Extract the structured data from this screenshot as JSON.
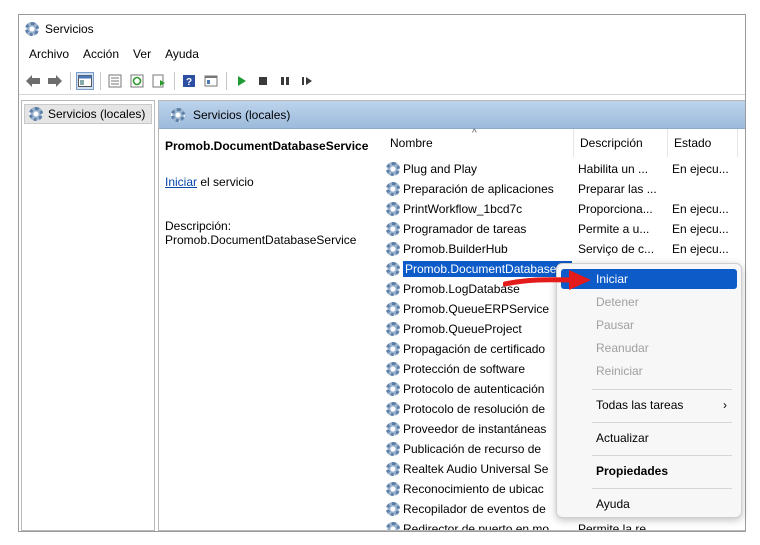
{
  "window": {
    "title": "Servicios"
  },
  "menu": [
    "Archivo",
    "Acción",
    "Ver",
    "Ayuda"
  ],
  "toolbar_icons": [
    "back-arrow-icon",
    "forward-arrow-icon",
    "console-tree-icon",
    "export-list-icon",
    "refresh-icon",
    "properties-icon",
    "help-icon",
    "view-icon",
    "play-icon",
    "stop-icon",
    "pause-icon",
    "resume-icon"
  ],
  "tree": {
    "item": "Servicios (locales)"
  },
  "pane": {
    "header": "Servicios (locales)"
  },
  "details": {
    "service_name": "Promob.DocumentDatabaseService",
    "start_link": "Iniciar",
    "start_suffix": " el servicio",
    "desc_label": "Descripción:",
    "desc_value": "Promob.DocumentDatabaseService"
  },
  "columns": {
    "name": "Nombre",
    "description": "Descripción",
    "status": "Estado"
  },
  "rows": [
    {
      "name": "Plug and Play",
      "description": "Habilita un ...",
      "status": "En ejecu..."
    },
    {
      "name": "Preparación de aplicaciones",
      "description": "Preparar las ...",
      "status": ""
    },
    {
      "name": "PrintWorkflow_1bcd7c",
      "description": "Proporciona...",
      "status": "En ejecu..."
    },
    {
      "name": "Programador de tareas",
      "description": "Permite a u...",
      "status": "En ejecu..."
    },
    {
      "name": "Promob.BuilderHub",
      "description": "Serviço de c...",
      "status": "En ejecu..."
    },
    {
      "name": "Promob.DocumentDatabaseService",
      "description": "",
      "status": ""
    },
    {
      "name": "Promob.LogDatabase",
      "description": "",
      "status": ""
    },
    {
      "name": "Promob.QueueERPService",
      "description": "",
      "status": ""
    },
    {
      "name": "Promob.QueueProject",
      "description": "",
      "status": ""
    },
    {
      "name": "Propagación de certificado",
      "description": "",
      "status": ""
    },
    {
      "name": "Protección de software",
      "description": "",
      "status": ""
    },
    {
      "name": "Protocolo de autenticación",
      "description": "",
      "status": ""
    },
    {
      "name": "Protocolo de resolución de",
      "description": "",
      "status": ""
    },
    {
      "name": "Proveedor de instantáneas",
      "description": "",
      "status": ""
    },
    {
      "name": "Publicación de recurso de",
      "description": "",
      "status": ""
    },
    {
      "name": "Realtek Audio Universal Se",
      "description": "",
      "status": ""
    },
    {
      "name": "Reconocimiento de ubicac",
      "description": "",
      "status": ""
    },
    {
      "name": "Recopilador de eventos de",
      "description": "",
      "status": ""
    },
    {
      "name": "Redirector de puerto en mo",
      "description": "Permite la re...",
      "status": ""
    }
  ],
  "context_menu": {
    "start": "Iniciar",
    "stop": "Detener",
    "pause": "Pausar",
    "resume": "Reanudar",
    "restart": "Reiniciar",
    "all_tasks": "Todas las tareas",
    "refresh": "Actualizar",
    "properties": "Propiedades",
    "help": "Ayuda"
  },
  "annotation": {
    "arrow_color": "#e31b1b"
  }
}
